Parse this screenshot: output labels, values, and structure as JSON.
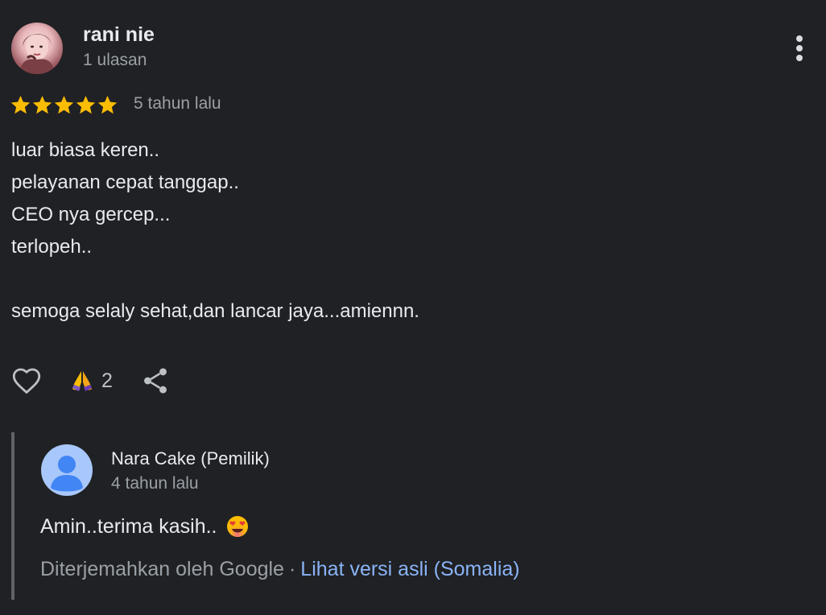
{
  "review": {
    "reviewer_name": "rani nie",
    "reviewer_count": "1 ulasan",
    "rating": 5,
    "rating_max": 5,
    "date": "5 tahun lalu",
    "body_lines": [
      "luar biasa keren..",
      "pelayanan cepat tanggap..",
      "CEO nya gercep...",
      "terlopeh..",
      "",
      "semoga selaly sehat,dan lancar jaya...amiennn."
    ],
    "reaction_count": "2",
    "icons": {
      "more": "more-vertical-icon",
      "like": "heart-outline-icon",
      "reaction": "folded-hands-emoji",
      "share": "share-icon",
      "star": "star-icon"
    }
  },
  "reply": {
    "owner_name": "Nara Cake (Pemilik)",
    "date": "4 tahun lalu",
    "text": "Amin..terima kasih..",
    "emoji": "heart-eyes-emoji",
    "translated_by": "Diterjemahkan oleh Google",
    "separator": "·",
    "original_link": "Lihat versi asli (Somalia)"
  },
  "colors": {
    "background": "#202124",
    "star": "#fbbc04",
    "link": "#8ab4f8",
    "secondary_text": "#9aa0a6",
    "owner_avatar": "#a8c7fa"
  }
}
